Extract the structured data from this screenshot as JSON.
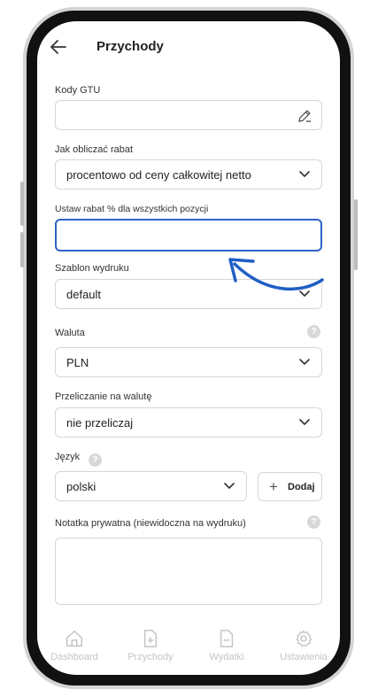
{
  "colors": {
    "accent": "#2f63c9",
    "arrow": "#1f5fc4",
    "border": "#d6d6d6",
    "nav_inactive": "#c4c4c4"
  },
  "header": {
    "title": "Przychody",
    "back_icon": "arrow-left-icon"
  },
  "form": {
    "gtu": {
      "label": "Kody GTU",
      "value": "",
      "icon": "pencil-icon"
    },
    "discount_method": {
      "label": "Jak obliczać rabat",
      "selected": "procentowo od ceny całkowitej netto"
    },
    "discount_percent": {
      "label": "Ustaw rabat % dla wszystkich pozycji",
      "value": ""
    },
    "print_template": {
      "label": "Szablon wydruku",
      "selected": "default"
    },
    "currency": {
      "label": "Waluta",
      "selected": "PLN",
      "help": "?"
    },
    "conversion": {
      "label": "Przeliczanie na walutę",
      "selected": "nie przeliczaj"
    },
    "language": {
      "label": "Język",
      "selected": "polski",
      "help": "?",
      "add_label": "Dodaj",
      "add_symbol": "+"
    },
    "private_note": {
      "label": "Notatka prywatna (niewidoczna na wydruku)",
      "value": "",
      "help": "?"
    }
  },
  "bottom_nav": {
    "items": [
      {
        "label": "Dashboard",
        "icon": "home-icon"
      },
      {
        "label": "Przychody",
        "icon": "file-plus-icon"
      },
      {
        "label": "Wydatki",
        "icon": "file-minus-icon"
      },
      {
        "label": "Ustawienia",
        "icon": "gear-icon"
      }
    ]
  }
}
